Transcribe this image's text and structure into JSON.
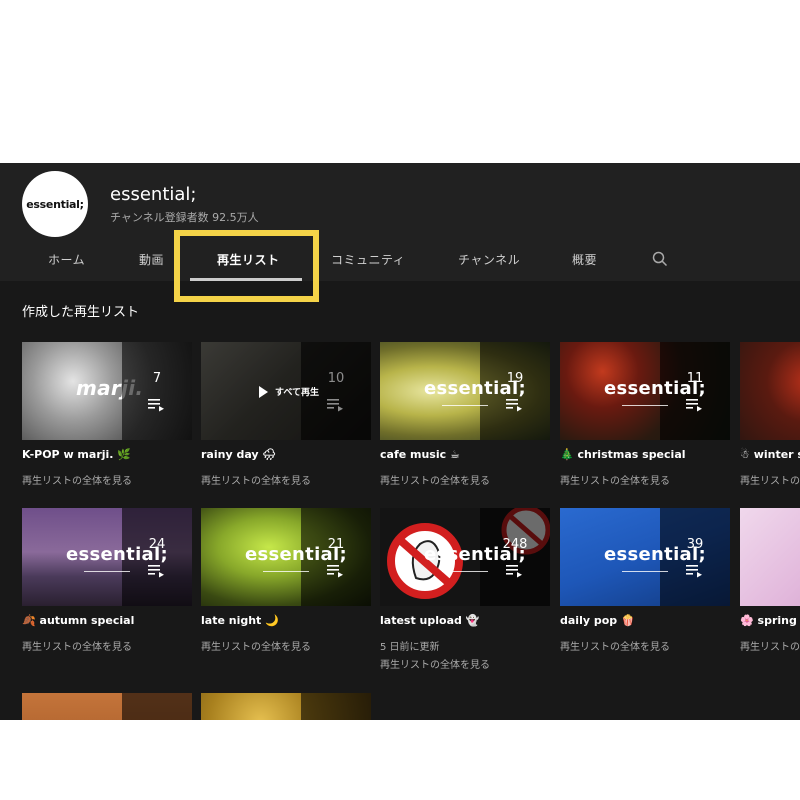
{
  "channel": {
    "avatar_text": "essential;",
    "name": "essential;",
    "subscribers": "チャンネル登録者数 92.5万人"
  },
  "tabs": [
    {
      "label": "ホーム"
    },
    {
      "label": "動画"
    },
    {
      "label": "再生リスト",
      "active": true
    },
    {
      "label": "コミュニティ"
    },
    {
      "label": "チャンネル"
    },
    {
      "label": "概要"
    }
  ],
  "icons": {
    "search": "search-icon",
    "playlist": "playlist-icon",
    "play": "play-icon"
  },
  "highlight_color": "#f4d348",
  "section_title": "作成した再生リスト",
  "logo_word": "essential;",
  "play_all_label": "すべて再生",
  "view_full_label": "再生リストの全体を見る",
  "playlists": [
    {
      "title": "K-POP w marji. 🌿",
      "count": "7",
      "logo": "marji."
    },
    {
      "title": "rainy day 🌧",
      "count": "10",
      "hover": true
    },
    {
      "title": "cafe music ☕",
      "count": "19"
    },
    {
      "title": "🎄 christmas special",
      "count": "11"
    },
    {
      "title": "☃ winter s"
    },
    {
      "title": "🍂 autumn special",
      "count": "24"
    },
    {
      "title": "late night 🌙",
      "count": "21"
    },
    {
      "title": "latest upload 👻",
      "count": "248",
      "updated": "5 日前に更新"
    },
    {
      "title": "daily pop 🍿",
      "count": "39"
    },
    {
      "title": "🌸 spring s"
    }
  ]
}
